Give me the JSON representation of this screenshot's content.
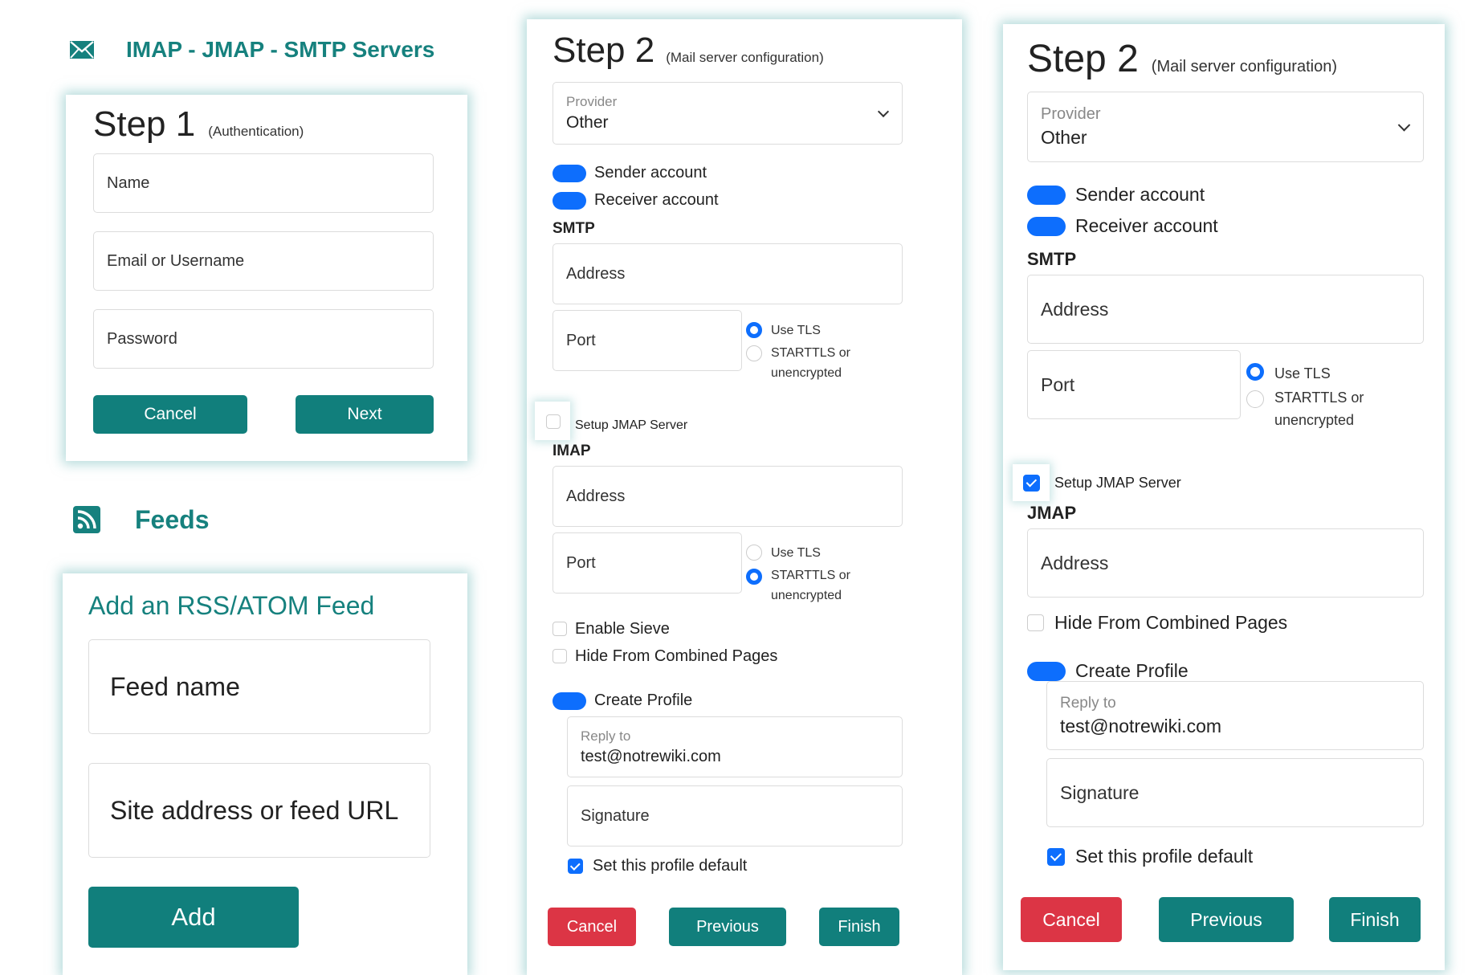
{
  "mail_section": {
    "title": "IMAP - JMAP - SMTP Servers",
    "icon": "envelope-icon"
  },
  "step1": {
    "title": "Step 1",
    "subtitle": "(Authentication)",
    "name_placeholder": "Name",
    "email_placeholder": "Email or Username",
    "password_placeholder": "Password",
    "cancel_label": "Cancel",
    "next_label": "Next"
  },
  "feeds_section": {
    "title": "Feeds",
    "icon": "rss-icon"
  },
  "feed_card": {
    "title": "Add an RSS/ATOM Feed",
    "feed_name_placeholder": "Feed name",
    "site_placeholder": "Site address or feed URL",
    "add_label": "Add"
  },
  "step2a": {
    "title": "Step 2",
    "subtitle": "(Mail server configuration)",
    "provider_label": "Provider",
    "provider_value": "Other",
    "sender_account": "Sender account",
    "receiver_account": "Receiver account",
    "smtp_heading": "SMTP",
    "smtp_address": "Address",
    "smtp_port": "Port",
    "use_tls": "Use TLS",
    "starttls_1": "STARTTLS or",
    "starttls_2": "unencrypted",
    "setup_jmap": "Setup JMAP Server",
    "imap_heading": "IMAP",
    "imap_address": "Address",
    "imap_port": "Port",
    "enable_sieve": "Enable Sieve",
    "hide_combined": "Hide From Combined Pages",
    "create_profile": "Create Profile",
    "reply_to_label": "Reply to",
    "reply_to_value": "test@notrewiki.com",
    "signature": "Signature",
    "profile_default": "Set this profile default",
    "cancel_label": "Cancel",
    "previous_label": "Previous",
    "finish_label": "Finish"
  },
  "step2b": {
    "title": "Step 2",
    "subtitle": "(Mail server configuration)",
    "provider_label": "Provider",
    "provider_value": "Other",
    "sender_account": "Sender account",
    "receiver_account": "Receiver account",
    "smtp_heading": "SMTP",
    "smtp_address": "Address",
    "smtp_port": "Port",
    "use_tls": "Use TLS",
    "starttls_1": "STARTTLS or",
    "starttls_2": "unencrypted",
    "setup_jmap": "Setup JMAP Server",
    "jmap_heading": "JMAP",
    "jmap_address": "Address",
    "hide_combined": "Hide From Combined Pages",
    "create_profile": "Create Profile",
    "reply_to_label": "Reply to",
    "reply_to_value": "test@notrewiki.com",
    "signature": "Signature",
    "profile_default": "Set this profile default",
    "cancel_label": "Cancel",
    "previous_label": "Previous",
    "finish_label": "Finish"
  },
  "colors": {
    "teal": "#117f7c",
    "heading_teal": "#16817e",
    "blue": "#0d6efd",
    "red": "#dc3545"
  }
}
